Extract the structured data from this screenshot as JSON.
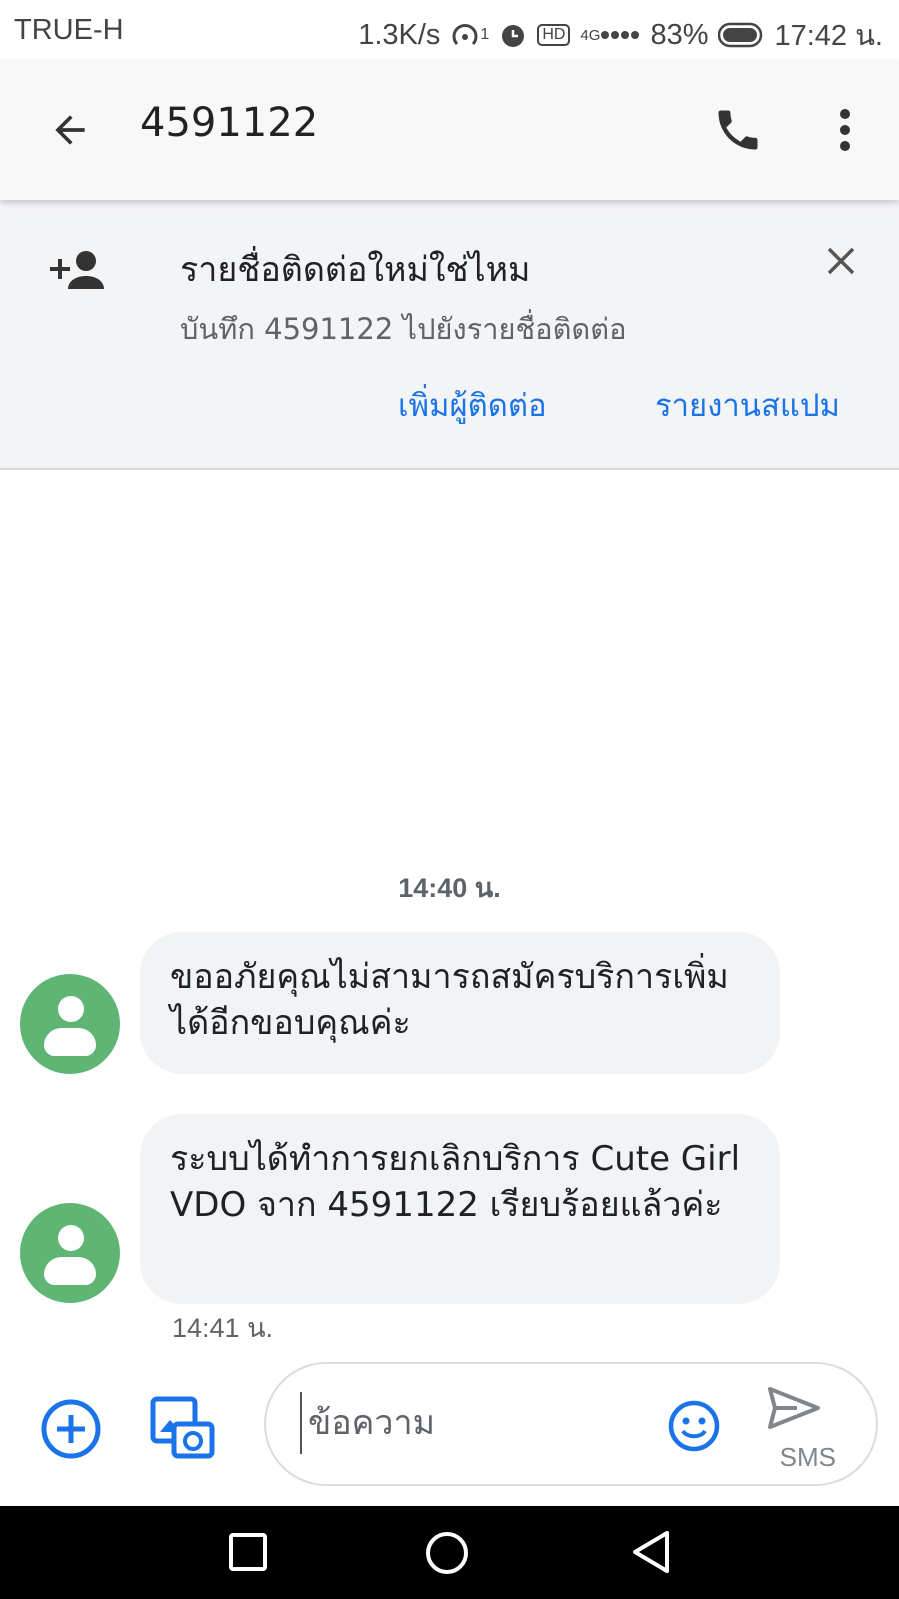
{
  "status_bar": {
    "carrier": "TRUE-H",
    "speed": "1.3K/s",
    "hotspot_count": "1",
    "hd": "HD",
    "network": "4G",
    "battery": "83%",
    "time": "17:42 น."
  },
  "app_bar": {
    "title": "4591122"
  },
  "banner": {
    "title": "รายชื่อติดต่อใหม่ใช่ไหม",
    "subtitle": "บันทึก 4591122 ไปยังรายชื่อติดต่อ",
    "add_contact": "เพิ่มผู้ติดต่อ",
    "report_spam": "รายงานสแปม"
  },
  "conversation": {
    "timestamp": "14:40 น.",
    "messages": [
      {
        "text": "ขออภัยคุณไม่สามารถสมัครบริการเพิ่มได้อีกขอบคุณค่ะ"
      },
      {
        "text": "ระบบได้ทำการยกเลิกบริการ Cute Girl VDO จาก 4591122 เรียบร้อยแล้วค่ะ"
      }
    ],
    "last_time": "14:41 น."
  },
  "composer": {
    "placeholder": "ข้อความ",
    "send_label": "SMS"
  },
  "colors": {
    "accent": "#1a73e8",
    "avatar": "#5fb574",
    "bubble": "#f1f3f4"
  }
}
